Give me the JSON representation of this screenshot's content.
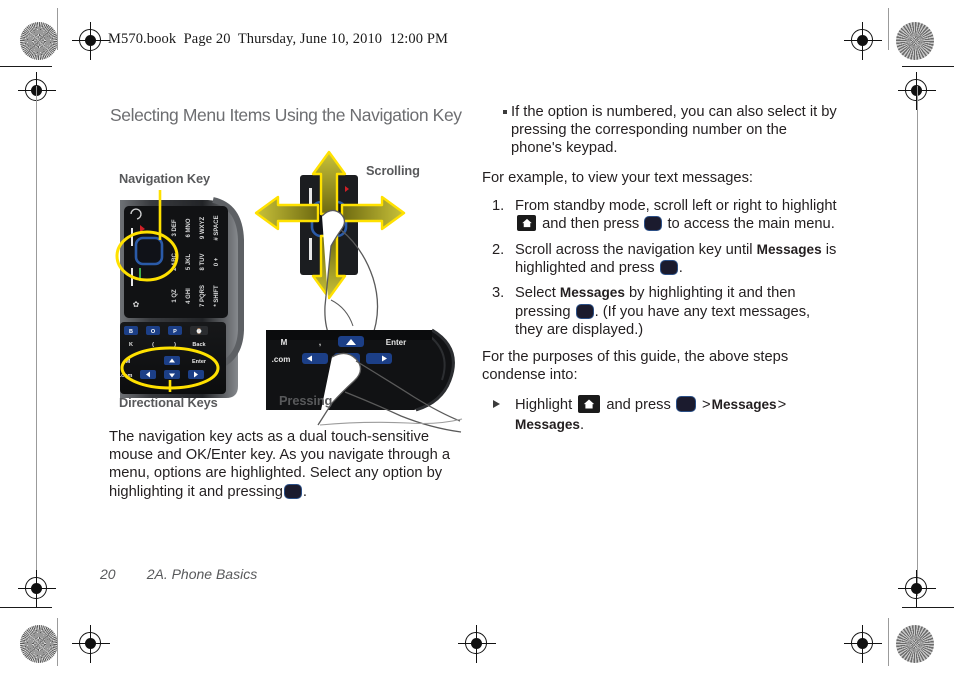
{
  "page": {
    "slug": "M570.book  Page 20  Thursday, June 10, 2010  12:00 PM",
    "heading": "Selecting Menu Items Using the Navigation Key",
    "footer": "20        2A. Phone Basics"
  },
  "figure": {
    "labels": {
      "navigation_key": "Navigation Key",
      "scrolling": "Scrolling",
      "directional_keys": "Directional Keys",
      "pressing": "Pressing"
    },
    "keycaps": {
      "enter": "Enter",
      "m": "M",
      "dotcom": ".com",
      "back": "Back",
      "zoom": "ZOOM",
      "k": "K",
      "comma": ",",
      "b": "B",
      "o": "O",
      "p": "P"
    },
    "keypad_digits": [
      "1",
      "2",
      "3",
      "4",
      "5",
      "6",
      "7",
      "8",
      "9",
      "*",
      "0",
      "#"
    ],
    "keypad_letters": [
      "QZ",
      "ABC",
      "DEF",
      "GHI",
      "JKL",
      "MNO",
      "PQRS",
      "TUV",
      "WXYZ"
    ]
  },
  "left_column": {
    "paragraph_1": "The navigation key acts as a dual touch-sensitive mouse and OK/Enter key. As you navigate through a menu, options are highlighted. Select any option by highlighting it and pressing",
    "paragraph_1_end": "."
  },
  "right_column": {
    "note_bullet": "If the option is numbered, you can also select it by pressing the corresponding number on the phone's keypad.",
    "lead_in": "For example, to view your text messages:",
    "steps": [
      {
        "number": "1.",
        "part_a": "From standby mode, scroll left or right to highlight",
        "icon_a": "home-icon",
        "part_b": "and then press",
        "icon_b": "press-icon",
        "part_c": "to access the main menu."
      },
      {
        "number": "2.",
        "part_a": "Scroll across the navigation key until",
        "bold_a": "Messages",
        "part_b": "is highlighted and press",
        "icon_b": "press-icon",
        "part_c": "."
      },
      {
        "number": "3.",
        "part_a": "Select",
        "bold_a": "Messages",
        "part_b": "by highlighting it and then pressing",
        "icon_b": "press-icon",
        "part_c": ". (If you have any text messages, they are displayed.)"
      }
    ],
    "condense_para": "For the purposes of this guide, the above steps condense into:",
    "shortcut": {
      "prefix": "Highlight",
      "icon_home": "home-icon",
      "mid": "and press",
      "icon_press": "press-icon",
      "sep1": ">",
      "menu_1": "Messages",
      "sep2": ">",
      "menu_2": "Messages",
      "period": "."
    }
  },
  "colors": {
    "heading_gray": "#6d6e71",
    "body_black": "#231f20",
    "label_gray": "#58595b",
    "highlight_yellow": "#ffe100",
    "arrow_olive": "#8a8419",
    "key_blue": "#1c3f87",
    "icon_navy": "#1b1b2e"
  }
}
